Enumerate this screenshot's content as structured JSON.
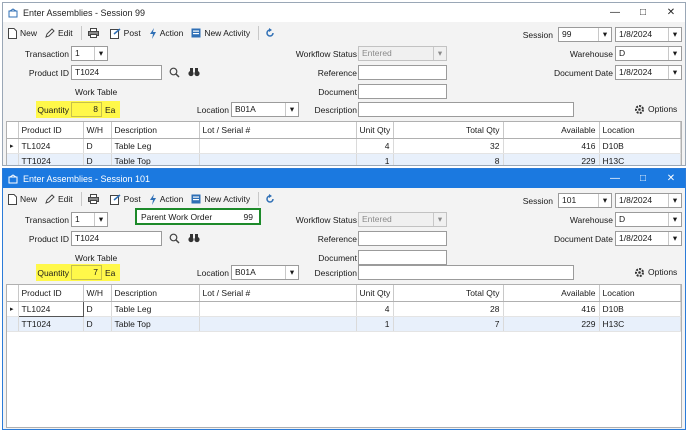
{
  "window1": {
    "title": "Enter Assemblies - Session 99",
    "toolbar": {
      "new": "New",
      "edit": "Edit",
      "post": "Post",
      "action": "Action",
      "new_activity": "New Activity"
    },
    "transaction_label": "Transaction",
    "transaction_value": "1",
    "product_id_label": "Product ID",
    "product_id_value": "T1024",
    "work_table_label": "Work Table",
    "quantity_label": "Quantity",
    "quantity_value": "8",
    "quantity_unit": "Ea",
    "location_label": "Location",
    "location_value": "B01A",
    "workflow_status_label": "Workflow Status",
    "workflow_status_value": "Entered",
    "reference_label": "Reference",
    "reference_value": "",
    "document_label": "Document",
    "document_value": "",
    "description_label": "Description",
    "description_value": "",
    "session_label": "Session",
    "session_value": "99",
    "session_date": "1/8/2024",
    "warehouse_label": "Warehouse",
    "warehouse_value": "D",
    "document_date_label": "Document Date",
    "document_date_value": "1/8/2024",
    "options_label": "Options",
    "columns": [
      "Product ID",
      "W/H",
      "Description",
      "Lot / Serial #",
      "Unit Qty",
      "Total Qty",
      "Available",
      "Location"
    ],
    "rows": [
      {
        "product_id": "TL1024",
        "wh": "D",
        "description": "Table Leg",
        "lot": "",
        "unit_qty": "4",
        "total_qty": "32",
        "available": "416",
        "location": "D10B"
      },
      {
        "product_id": "TT1024",
        "wh": "D",
        "description": "Table Top",
        "lot": "",
        "unit_qty": "1",
        "total_qty": "8",
        "available": "229",
        "location": "H13C"
      }
    ]
  },
  "window2": {
    "title": "Enter Assemblies - Session 101",
    "toolbar": {
      "new": "New",
      "edit": "Edit",
      "post": "Post",
      "action": "Action",
      "new_activity": "New Activity"
    },
    "transaction_label": "Transaction",
    "transaction_value": "1",
    "parent_work_order_label": "Parent Work Order",
    "parent_work_order_value": "99",
    "product_id_label": "Product ID",
    "product_id_value": "T1024",
    "work_table_label": "Work Table",
    "quantity_label": "Quantity",
    "quantity_value": "7",
    "quantity_unit": "Ea",
    "location_label": "Location",
    "location_value": "B01A",
    "workflow_status_label": "Workflow Status",
    "workflow_status_value": "Entered",
    "reference_label": "Reference",
    "reference_value": "",
    "document_label": "Document",
    "document_value": "",
    "description_label": "Description",
    "description_value": "",
    "session_label": "Session",
    "session_value": "101",
    "session_date": "1/8/2024",
    "warehouse_label": "Warehouse",
    "warehouse_value": "D",
    "document_date_label": "Document Date",
    "document_date_value": "1/8/2024",
    "options_label": "Options",
    "columns": [
      "Product ID",
      "W/H",
      "Description",
      "Lot / Serial #",
      "Unit Qty",
      "Total Qty",
      "Available",
      "Location"
    ],
    "rows": [
      {
        "product_id": "TL1024",
        "wh": "D",
        "description": "Table Leg",
        "lot": "",
        "unit_qty": "4",
        "total_qty": "28",
        "available": "416",
        "location": "D10B"
      },
      {
        "product_id": "TT1024",
        "wh": "D",
        "description": "Table Top",
        "lot": "",
        "unit_qty": "1",
        "total_qty": "7",
        "available": "229",
        "location": "H13C"
      }
    ]
  },
  "colors": {
    "highlight": "#fff84a",
    "active_title": "#1b79e0",
    "parent_border": "#1d8a2a"
  },
  "icons": [
    "window-icon",
    "new-icon",
    "edit-icon",
    "print-icon",
    "post-icon",
    "action-icon",
    "new-activity-icon",
    "refresh-icon",
    "search-icon",
    "binoculars-icon",
    "options-icon",
    "minimize-icon",
    "maximize-icon",
    "close-icon"
  ]
}
